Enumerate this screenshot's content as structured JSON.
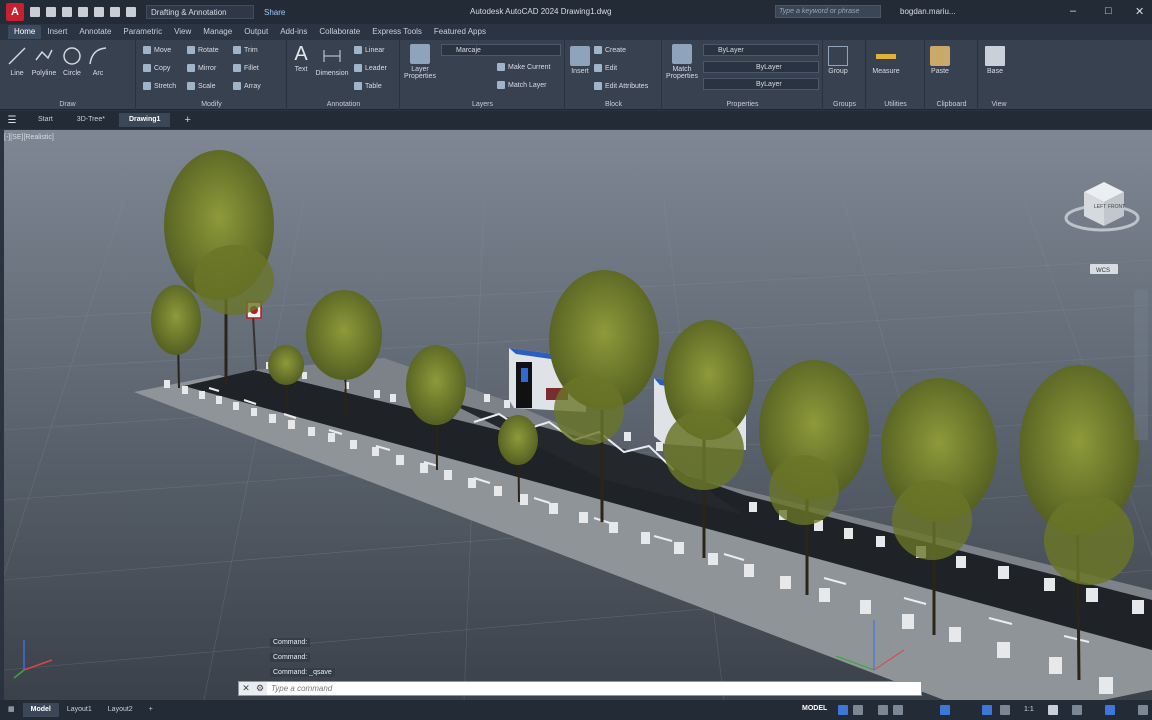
{
  "app": {
    "logo_letter": "A",
    "workspace": "Drafting & Annotation",
    "share": "Share",
    "title": "Autodesk AutoCAD 2024    Drawing1.dwg",
    "search_placeholder": "Type a keyword or phrase",
    "user": "bogdan.mariu..."
  },
  "ribbon_tabs": [
    "Home",
    "Insert",
    "Annotate",
    "Parametric",
    "View",
    "Manage",
    "Output",
    "Add-ins",
    "Collaborate",
    "Express Tools",
    "Featured Apps"
  ],
  "draw": {
    "title": "Draw",
    "line": "Line",
    "polyline": "Polyline",
    "circle": "Circle",
    "arc": "Arc"
  },
  "modify": {
    "title": "Modify",
    "move": "Move",
    "rotate": "Rotate",
    "trim": "Trim",
    "copy": "Copy",
    "mirror": "Mirror",
    "fillet": "Fillet",
    "stretch": "Stretch",
    "scale": "Scale",
    "array": "Array"
  },
  "annotation": {
    "title": "Annotation",
    "text": "Text",
    "dimension": "Dimension",
    "linear": "Linear",
    "leader": "Leader",
    "table": "Table"
  },
  "layers": {
    "title": "Layers",
    "layer_properties": "Layer Properties",
    "current_layer": "Marcaje",
    "make_current": "Make Current",
    "match_layer": "Match Layer"
  },
  "block": {
    "title": "Block",
    "insert": "Insert",
    "create": "Create",
    "edit": "Edit",
    "edit_attributes": "Edit Attributes"
  },
  "properties": {
    "title": "Properties",
    "match_properties": "Match Properties",
    "color": "ByLayer",
    "linetype": "ByLayer",
    "lineweight": "ByLayer"
  },
  "groups": {
    "title": "Groups",
    "group": "Group"
  },
  "utilities": {
    "title": "Utilities",
    "measure": "Measure"
  },
  "clipboard": {
    "title": "Clipboard",
    "paste": "Paste"
  },
  "view_panel": {
    "title": "View",
    "base": "Base"
  },
  "file_tabs": [
    "Start",
    "3D-Tree*",
    "Drawing1"
  ],
  "viewport": {
    "label": "[-][SE][Realistic]",
    "viewcube_top": "TOP",
    "viewcube_left": "LEFT",
    "viewcube_front": "FRONT",
    "wcs": "WCS"
  },
  "command": {
    "history": [
      "Command:",
      "Command:",
      "Command: _qsave"
    ],
    "placeholder": "Type a command"
  },
  "status": {
    "layout_tabs": [
      "Model",
      "Layout1",
      "Layout2"
    ],
    "model": "MODEL",
    "scale": "1:1"
  },
  "colors": {
    "accent": "#c8202f",
    "ribbon": "#37414f",
    "asphalt": "#1f2226",
    "curb": "#8f9499",
    "foliage": "#6d7a2e"
  }
}
